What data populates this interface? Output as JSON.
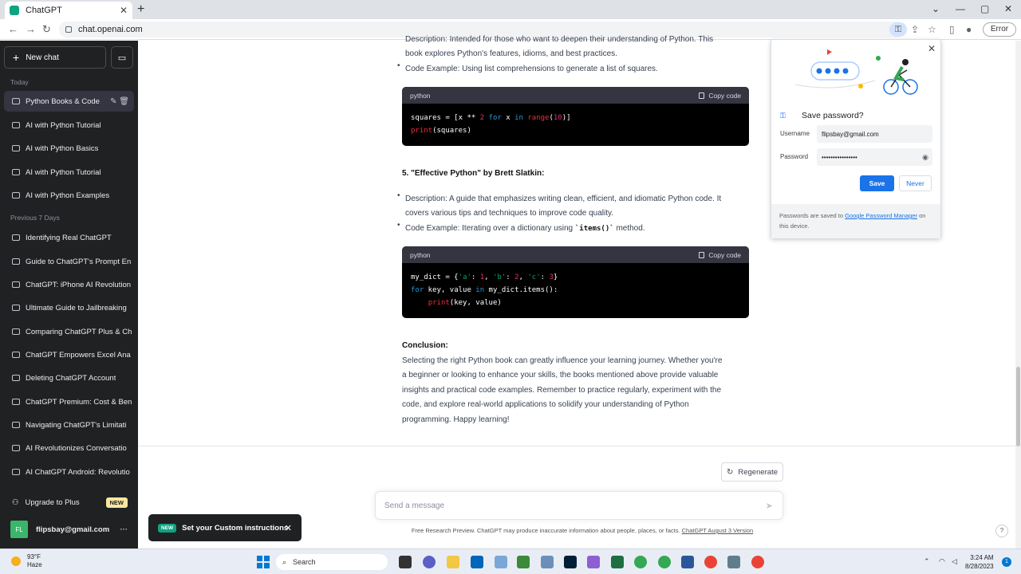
{
  "browser": {
    "tab_title": "ChatGPT",
    "url": "chat.openai.com",
    "error_label": "Error"
  },
  "sidebar": {
    "new_chat": "New chat",
    "today_label": "Today",
    "prev7_label": "Previous 7 Days",
    "today_items": [
      {
        "label": "Python Books & Code"
      },
      {
        "label": "AI with Python Tutorial"
      },
      {
        "label": "AI with Python Basics"
      },
      {
        "label": "AI with Python Tutorial"
      },
      {
        "label": "AI with Python Examples"
      }
    ],
    "prev_items": [
      {
        "label": "Identifying Real ChatGPT"
      },
      {
        "label": "Guide to ChatGPT's Prompt En"
      },
      {
        "label": "ChatGPT: iPhone AI Revolution"
      },
      {
        "label": "Ultimate Guide to Jailbreaking"
      },
      {
        "label": "Comparing ChatGPT Plus & Ch"
      },
      {
        "label": "ChatGPT Empowers Excel Ana"
      },
      {
        "label": "Deleting ChatGPT Account"
      },
      {
        "label": "ChatGPT Premium: Cost & Ben"
      },
      {
        "label": "Navigating ChatGPT's Limitati"
      },
      {
        "label": "AI Revolutionizes Conversatio"
      },
      {
        "label": "AI ChatGPT Android: Revolutio"
      }
    ],
    "upgrade_label": "Upgrade to Plus",
    "new_badge": "NEW",
    "user_initials": "FL",
    "user_email": "flipsbay@gmail.com"
  },
  "content": {
    "para_top_1": "Description: Intended for those who want to deepen their understanding of Python. This",
    "para_top_2": "book explores Python's features, idioms, and best practices.",
    "bullet_code1": "Code Example: Using list comprehensions to generate a list of squares.",
    "code_lang": "python",
    "copy_label": "Copy code",
    "heading5": "5. \"Effective Python\" by Brett Slatkin:",
    "desc5_1": "Description: A guide that emphasizes writing clean, efficient, and idiomatic Python code. It",
    "desc5_2": "covers various tips and techniques to improve code quality.",
    "code5_prefix": "Code Example: Iterating over a dictionary using ",
    "code5_inline": "`items()`",
    "code5_suffix": " method.",
    "conclusion_heading": "Conclusion:",
    "conclusion_lines": [
      "Selecting the right Python book can greatly influence your learning journey. Whether you're",
      "a beginner or looking to enhance your skills, the books mentioned above provide valuable",
      "insights and practical code examples. Remember to practice regularly, experiment with the",
      "code, and explore real-world applications to solidify your understanding of Python",
      "programming. Happy learning!"
    ]
  },
  "composer": {
    "regenerate": "Regenerate",
    "placeholder": "Send a message",
    "footer_text": "Free Research Preview. ChatGPT may produce inaccurate information about people, places, or facts.",
    "footer_link": "ChatGPT August 3 Version",
    "help": "?"
  },
  "toast": {
    "badge": "NEW",
    "text": "Set your Custom instructions"
  },
  "password_popup": {
    "title": "Save password?",
    "username_label": "Username",
    "username_value": "flipsbay@gmail.com",
    "password_label": "Password",
    "password_value": "••••••••••••••••",
    "save": "Save",
    "never": "Never",
    "footer_pre": "Passwords are saved to ",
    "footer_link": "Google Password Manager",
    "footer_post": " on this device."
  },
  "taskbar": {
    "temp": "93°F",
    "condition": "Haze",
    "search": "Search",
    "time": "3:24 AM",
    "date": "8/28/2023",
    "notifications": "1"
  }
}
